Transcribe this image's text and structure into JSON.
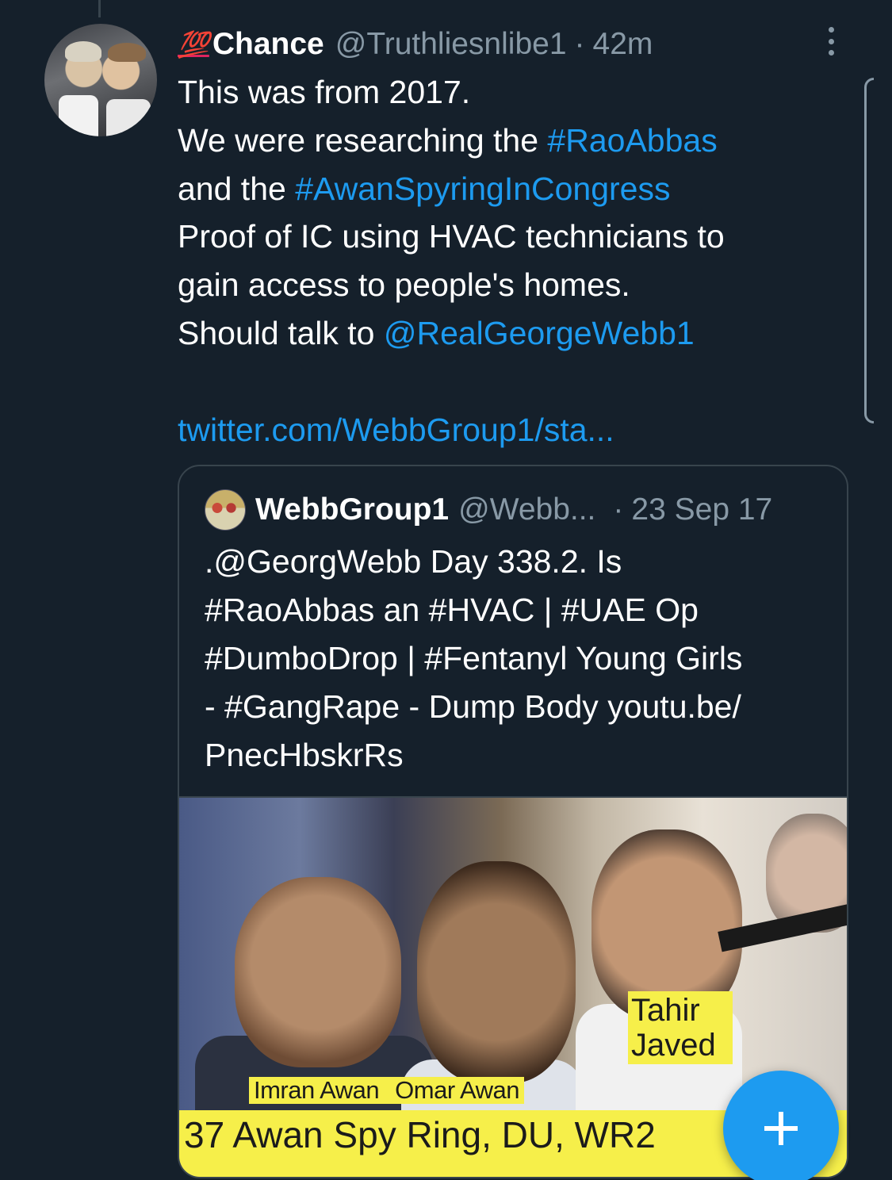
{
  "tweet": {
    "badge_emoji": "💯",
    "name": "Chance",
    "handle": "@Truthliesnlibe1",
    "separator": "·",
    "time": "42m",
    "lines": [
      [
        {
          "t": "This was from 2017.",
          "link": false
        }
      ],
      [
        {
          "t": "We were researching the ",
          "link": false
        },
        {
          "t": "#RaoAbbas",
          "link": true
        }
      ],
      [
        {
          "t": "and the ",
          "link": false
        },
        {
          "t": "#AwanSpyringInCongress",
          "link": true
        }
      ],
      [
        {
          "t": "Proof of IC using HVAC technicians to",
          "link": false
        }
      ],
      [
        {
          "t": "gain access to people's homes.",
          "link": false
        }
      ],
      [
        {
          "t": "Should talk to ",
          "link": false
        },
        {
          "t": "@RealGeorgeWebb1",
          "link": true
        }
      ]
    ],
    "url": "twitter.com/WebbGroup1/sta..."
  },
  "quoted_tweet": {
    "name": "WebbGroup1",
    "handle": "@Webb...",
    "separator": "·",
    "date": "23 Sep 17",
    "lines": [
      ".@GeorgWebb Day 338.2. Is",
      "#RaoAbbas an #HVAC | #UAE Op",
      "#DumboDrop | #Fentanyl Young Girls",
      "- #GangRape - Dump Body youtu.be/",
      "PnecHbskrRs"
    ],
    "media": {
      "caption_names": [
        "Imran Awan",
        "Omar Awan"
      ],
      "caption_tahir": [
        "Tahir",
        "Javed"
      ],
      "banner": "37 Awan Spy Ring, DU, WR2"
    }
  },
  "icons": {
    "more": "more-vertical-icon",
    "compose": "plus-icon"
  },
  "colors": {
    "background": "#15202b",
    "link": "#1d9bf0",
    "muted": "#8899a6",
    "caption": "#f6ef4a"
  }
}
